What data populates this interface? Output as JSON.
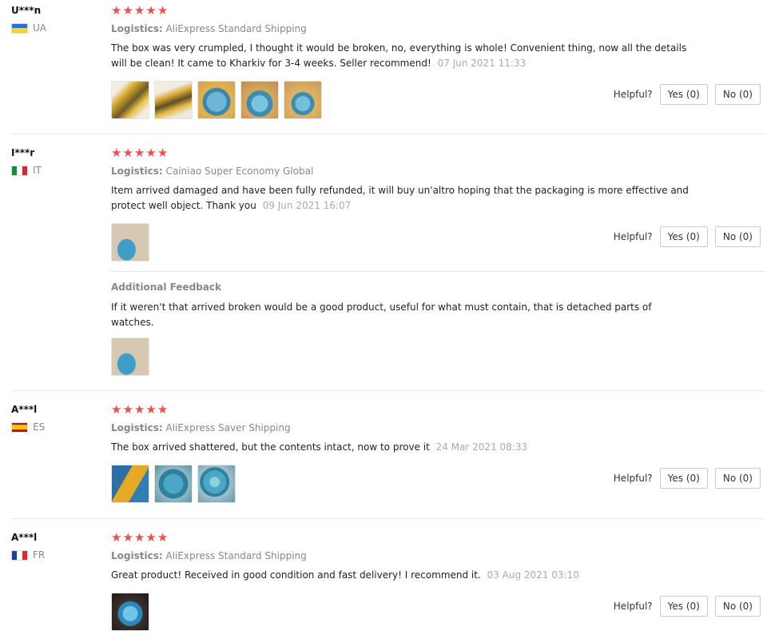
{
  "reviews": [
    {
      "username": "U***n",
      "country": "UA",
      "flag_colors": [
        "#2a6fd6",
        "#f5d32a"
      ],
      "logistics_label": "Logistics:",
      "logistics": "AliExpress Standard Shipping",
      "text": "The box was very crumpled, I thought it would be broken, no, everything is whole! Convenient thing, now all the details will be clean! It came to Kharkiv for 3-4 weeks. Seller recommend!",
      "date": "07 Jun 2021 11:33",
      "helpful_label": "Helpful?",
      "yes_label": "Yes (0)",
      "no_label": "No (0)"
    },
    {
      "username": "I***r",
      "country": "IT",
      "flag_colors": [
        "#1f8a3c",
        "#ffffff",
        "#cf2b37"
      ],
      "logistics_label": "Logistics:",
      "logistics": "Cainiao Super Economy Global",
      "text": "Item arrived damaged and have been fully refunded, it will buy un'altro hoping that the packaging is more effective and protect well object. Thank you",
      "date": "09 Jun 2021 16:07",
      "helpful_label": "Helpful?",
      "yes_label": "Yes (0)",
      "no_label": "No (0)",
      "additional_title": "Additional Feedback",
      "additional_text": "If it weren't that arrived broken would be a good product, useful for what must contain, that is detached parts of watches."
    },
    {
      "username": "A***l",
      "country": "ES",
      "flag_colors": [
        "#c60b1e",
        "#ffc400",
        "#c60b1e"
      ],
      "logistics_label": "Logistics:",
      "logistics": "AliExpress Saver Shipping",
      "text": "The box arrived shattered, but the contents intact, now to prove it",
      "date": "24 Mar 2021 08:33",
      "helpful_label": "Helpful?",
      "yes_label": "Yes (0)",
      "no_label": "No (0)"
    },
    {
      "username": "A***l",
      "country": "FR",
      "flag_colors": [
        "#1d3f9e",
        "#ffffff",
        "#e4272f"
      ],
      "logistics_label": "Logistics:",
      "logistics": "AliExpress Standard Shipping",
      "text": "Great product! Received in good condition and fast delivery! I recommend it.",
      "date": "03 Aug 2021 03:10",
      "helpful_label": "Helpful?",
      "yes_label": "Yes (0)",
      "no_label": "No (0)"
    }
  ],
  "rating": {
    "stars": 5,
    "max": 5
  },
  "colors": {
    "star": "#f04d4d",
    "muted": "#888888",
    "date": "#aaaaaa"
  }
}
